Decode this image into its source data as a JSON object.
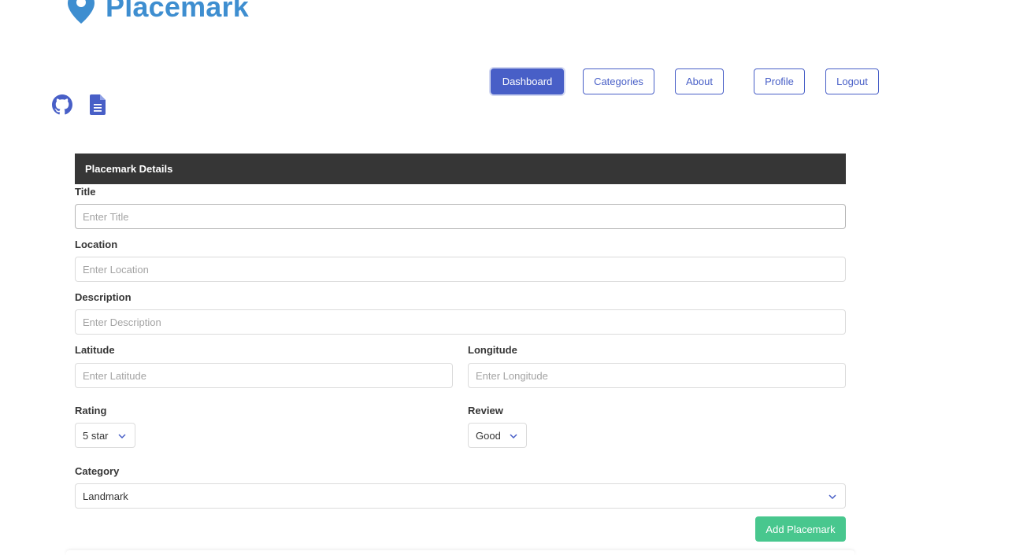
{
  "brand": {
    "name": "Placemark",
    "color": "#3e8ed0",
    "icon": "map-pin-icon"
  },
  "nav": {
    "items": [
      {
        "label": "Dashboard",
        "active": true
      },
      {
        "label": "Categories"
      },
      {
        "label": "About"
      },
      {
        "label": "Profile"
      },
      {
        "label": "Logout"
      }
    ]
  },
  "social": {
    "icons": [
      "github-icon",
      "document-icon"
    ]
  },
  "form": {
    "heading": "Placemark Details",
    "title": {
      "label": "Title",
      "placeholder": "Enter Title",
      "value": ""
    },
    "location": {
      "label": "Location",
      "placeholder": "Enter Location",
      "value": ""
    },
    "description": {
      "label": "Description",
      "placeholder": "Enter Description",
      "value": ""
    },
    "latitude": {
      "label": "Latitude",
      "placeholder": "Enter Latitude",
      "value": ""
    },
    "longitude": {
      "label": "Longitude",
      "placeholder": "Enter Longitude",
      "value": ""
    },
    "rating": {
      "label": "Rating",
      "selected": "5 star"
    },
    "review": {
      "label": "Review",
      "selected": "Good"
    },
    "category": {
      "label": "Category",
      "selected": "Landmark"
    },
    "submit_label": "Add Placemark"
  },
  "colors": {
    "primary": "#485fc7",
    "success": "#48c78e",
    "header_dark": "#363636",
    "link": "#3e8ed0"
  }
}
